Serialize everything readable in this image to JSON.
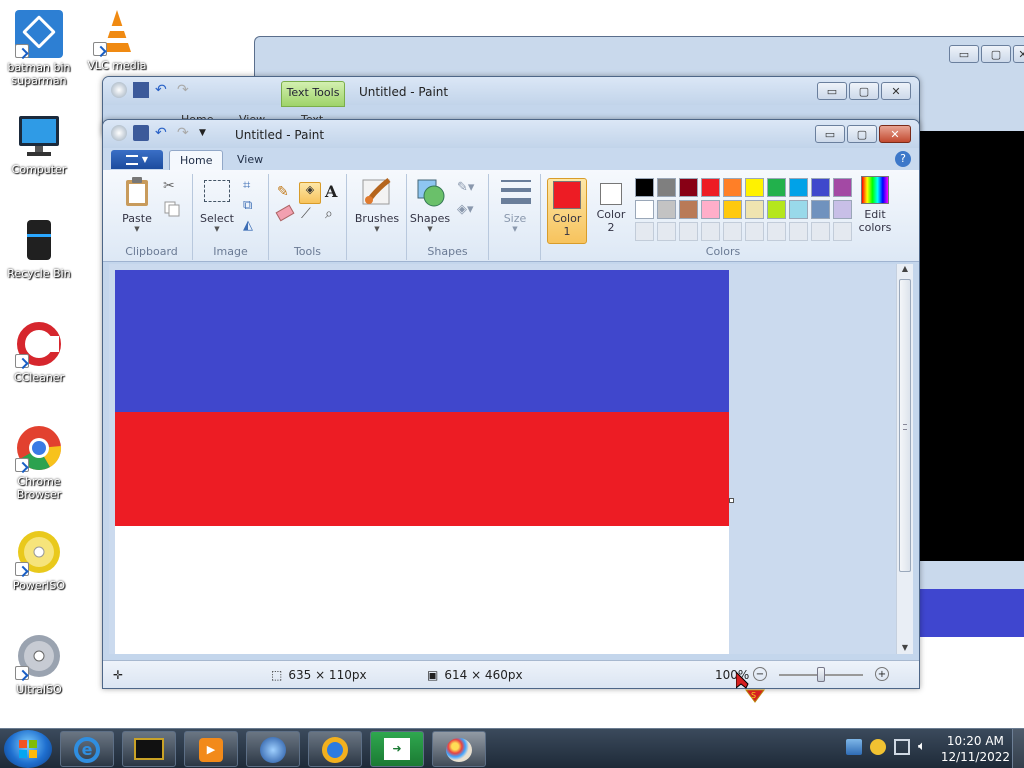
{
  "desktop": {
    "icons": [
      {
        "label": "batman bin suparman"
      },
      {
        "label": "VLC media"
      },
      {
        "label": "Computer"
      },
      {
        "label": "Recycle Bin"
      },
      {
        "label": "CCleaner"
      },
      {
        "label": "Chrome Browser"
      },
      {
        "label": "PowerISO"
      },
      {
        "label": "UltraISO"
      }
    ]
  },
  "back_window": {
    "title": "Untitled - Paint",
    "contextual_tab": "Text Tools",
    "tabs": [
      "Home",
      "View",
      "Text"
    ]
  },
  "paint": {
    "title": "Untitled - Paint",
    "tabs": {
      "home": "Home",
      "view": "View"
    },
    "groups": {
      "clipboard": "Clipboard",
      "image": "Image",
      "tools": "Tools",
      "shapes": "Shapes",
      "colors": "Colors"
    },
    "buttons": {
      "paste": "Paste",
      "select": "Select",
      "brushes": "Brushes",
      "shapes": "Shapes",
      "size": "Size",
      "color1": "Color\n1",
      "color1_a": "Color",
      "color1_b": "1",
      "color2_a": "Color",
      "color2_b": "2",
      "edit_a": "Edit",
      "edit_b": "colors"
    },
    "palette_row1": [
      "#000000",
      "#7f7f7f",
      "#880015",
      "#ed1c24",
      "#ff7f27",
      "#fff200",
      "#22b14c",
      "#00a2e8",
      "#3f48cc",
      "#a349a4"
    ],
    "palette_row2": [
      "#ffffff",
      "#c3c3c3",
      "#b97a57",
      "#ffaec9",
      "#ffc90e",
      "#efe4b0",
      "#b5e61d",
      "#99d9ea",
      "#7092be",
      "#c8bfe7"
    ],
    "color1": "#ed1c24",
    "color2": "#ffffff",
    "canvas_bands": [
      {
        "color": "#4047cc"
      },
      {
        "color": "#ed1c24"
      },
      {
        "color": "#ffffff"
      }
    ],
    "status": {
      "selection_size": "635 × 110px",
      "image_size": "614 × 460px",
      "zoom": "100%"
    }
  },
  "taskbar": {
    "time": "10:20 AM",
    "date": "12/11/2022"
  }
}
